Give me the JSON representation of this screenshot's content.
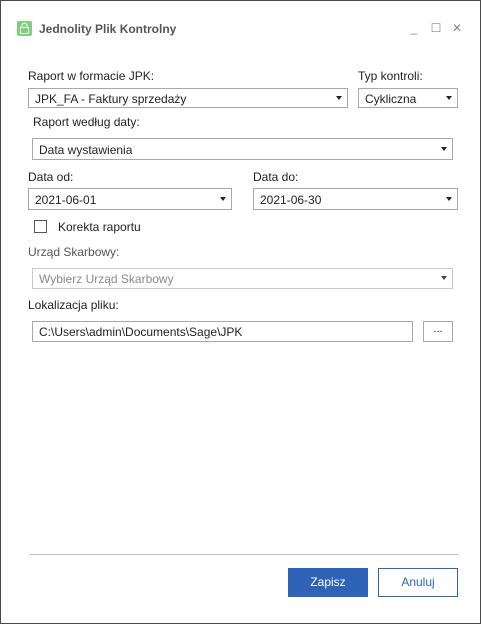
{
  "window": {
    "title": "Jednolity Plik Kontrolny",
    "minimize_glyph": "_",
    "maximize_glyph": "☐",
    "close_glyph": "✕"
  },
  "form": {
    "report_format": {
      "label": "Raport w formacie JPK:",
      "selected": "JPK_FA - Faktury sprzedaży"
    },
    "control_type": {
      "label": "Typ kontroli:",
      "selected": "Cykliczna"
    },
    "report_by_date": {
      "label": "Raport według daty:",
      "selected": "Data wystawienia"
    },
    "date_from": {
      "label": "Data od:",
      "value": "2021-06-01"
    },
    "date_to": {
      "label": "Data do:",
      "value": "2021-06-30"
    },
    "correction": {
      "label": "Korekta raportu",
      "checked": false
    },
    "tax_office": {
      "label": "Urząd Skarbowy:",
      "placeholder": "Wybierz Urząd Skarbowy"
    },
    "file_location": {
      "label": "Lokalizacja pliku:",
      "value": "C:\\Users\\admin\\Documents\\Sage\\JPK",
      "browse_label": "..."
    }
  },
  "footer": {
    "save_label": "Zapisz",
    "cancel_label": "Anuluj"
  },
  "colors": {
    "primary": "#2f63b7",
    "app_icon": "#7ed07e"
  },
  "icons": {
    "app": "lock-icon",
    "dropdown": "chevron-down-icon"
  }
}
